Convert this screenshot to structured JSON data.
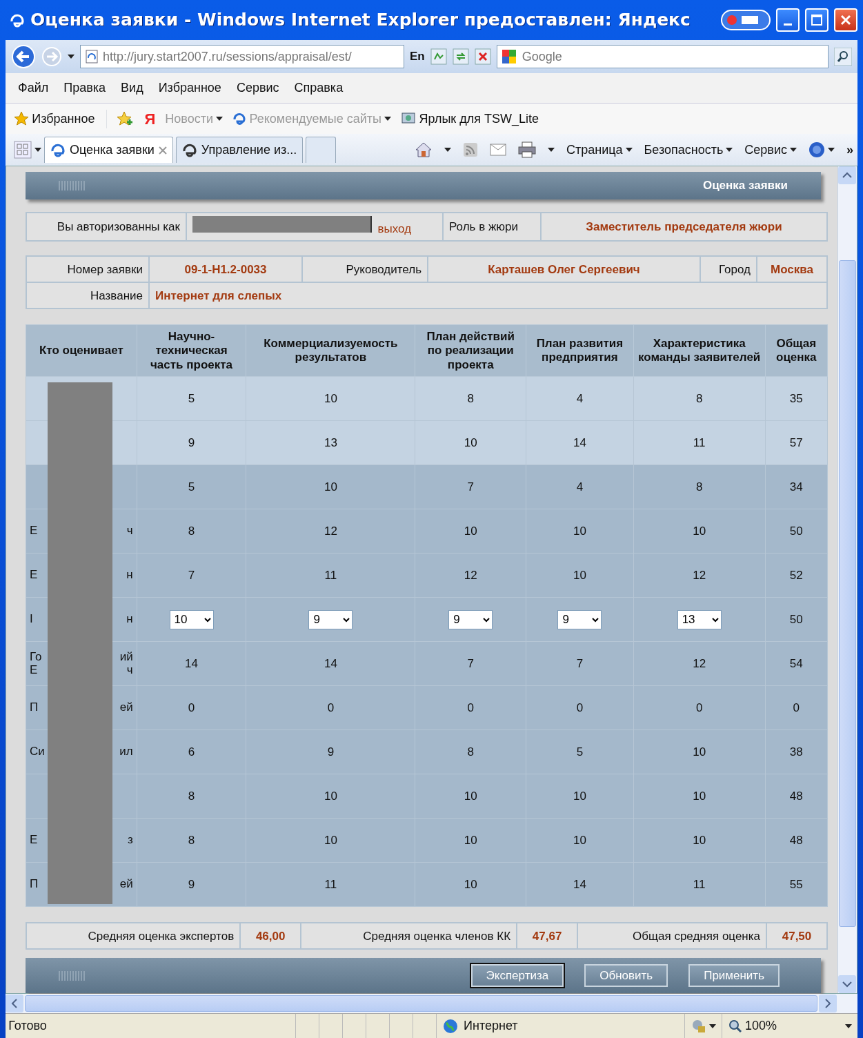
{
  "window": {
    "title": "Оценка заявки - Windows Internet Explorer предоставлен: Яндекс"
  },
  "address_bar": {
    "url": "http://jury.start2007.ru/sessions/appraisal/est/",
    "language": "En",
    "search_placeholder": "Google"
  },
  "menu": [
    "Файл",
    "Правка",
    "Вид",
    "Избранное",
    "Сервис",
    "Справка"
  ],
  "favorites_bar": {
    "favorites": "Избранное",
    "yandex_logo": "Я",
    "links": [
      {
        "label": "Новости",
        "dropdown": true,
        "disabled": true
      },
      {
        "label": "Рекомендуемые сайты",
        "dropdown": true,
        "disabled": true
      },
      {
        "label": "Ярлык для TSW_Lite",
        "dropdown": false,
        "disabled": false
      }
    ]
  },
  "tabs": [
    {
      "label": "Оценка заявки",
      "selected": true
    },
    {
      "label": "Управление из...",
      "selected": false
    }
  ],
  "command_bar": {
    "items": [
      "Страница",
      "Безопасность",
      "Сервис"
    ],
    "overflow": "»"
  },
  "page": {
    "header": "Оценка заявки",
    "auth": {
      "label": "Вы авторизованны как",
      "logout": "выход",
      "role_label": "Роль в жюри",
      "role": "Заместитель председателя жюри"
    },
    "application": {
      "number_label": "Номер заявки",
      "number": "09-1-H1.2-0033",
      "leader_label": "Руководитель",
      "leader": "Карташев Олег Сергеевич",
      "city_label": "Город",
      "city": "Москва",
      "name_label": "Название",
      "name": "Интернет для слепых"
    },
    "scores": {
      "columns": [
        "Кто оценивает",
        "Научно-техническая часть проекта",
        "Коммерциализуемость результатов",
        "План действий по реализации проекта",
        "План развития предприятия",
        "Характеристика команды заявителей",
        "Общая оценка"
      ],
      "rows": [
        {
          "kind": "expert",
          "evaluator": [],
          "values": [
            "5",
            "10",
            "8",
            "4",
            "8"
          ],
          "total": "35"
        },
        {
          "kind": "expert",
          "evaluator": [],
          "values": [
            "9",
            "13",
            "10",
            "14",
            "11"
          ],
          "total": "57"
        },
        {
          "kind": "member",
          "evaluator": [],
          "values": [
            "5",
            "10",
            "7",
            "4",
            "8"
          ],
          "total": "34"
        },
        {
          "kind": "member",
          "evaluator": [
            [
              "Е",
              "ч"
            ]
          ],
          "values": [
            "8",
            "12",
            "10",
            "10",
            "10"
          ],
          "total": "50"
        },
        {
          "kind": "member",
          "evaluator": [
            [
              "Е",
              "н"
            ]
          ],
          "values": [
            "7",
            "11",
            "12",
            "10",
            "12"
          ],
          "total": "52"
        },
        {
          "kind": "own",
          "evaluator": [
            [
              "I",
              "н"
            ]
          ],
          "values": [
            "10",
            "9",
            "9",
            "9",
            "13"
          ],
          "total": "50"
        },
        {
          "kind": "member",
          "evaluator": [
            [
              "Го",
              "ий"
            ],
            [
              "Е",
              "ч"
            ]
          ],
          "values": [
            "14",
            "14",
            "7",
            "7",
            "12"
          ],
          "total": "54"
        },
        {
          "kind": "member",
          "evaluator": [
            [
              "П",
              "ей"
            ]
          ],
          "values": [
            "0",
            "0",
            "0",
            "0",
            "0"
          ],
          "total": "0"
        },
        {
          "kind": "member",
          "evaluator": [
            [
              "Си",
              "ил"
            ]
          ],
          "values": [
            "6",
            "9",
            "8",
            "5",
            "10"
          ],
          "total": "38"
        },
        {
          "kind": "member",
          "evaluator": [],
          "values": [
            "8",
            "10",
            "10",
            "10",
            "10"
          ],
          "total": "48"
        },
        {
          "kind": "member",
          "evaluator": [
            [
              "Е",
              "з"
            ]
          ],
          "values": [
            "8",
            "10",
            "10",
            "10",
            "10"
          ],
          "total": "48"
        },
        {
          "kind": "member",
          "evaluator": [
            [
              "П",
              "ей"
            ]
          ],
          "values": [
            "9",
            "11",
            "10",
            "14",
            "11"
          ],
          "total": "55"
        }
      ]
    },
    "averages": [
      {
        "label": "Средняя оценка экспертов",
        "value": "46,00"
      },
      {
        "label": "Средняя оценка членов КК",
        "value": "47,67"
      },
      {
        "label": "Общая средняя оценка",
        "value": "47,50"
      }
    ],
    "buttons": [
      {
        "label": "Экспертиза",
        "focused": true
      },
      {
        "label": "Обновить",
        "focused": false
      },
      {
        "label": "Применить",
        "focused": false
      }
    ]
  },
  "status_bar": {
    "text": "Готово",
    "zone": "Интернет",
    "zoom": "100%"
  }
}
